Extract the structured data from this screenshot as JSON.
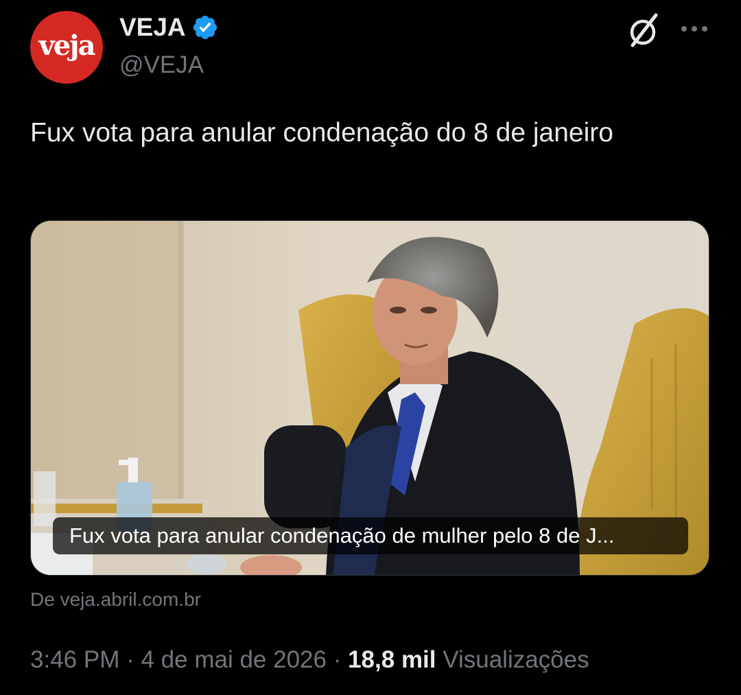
{
  "author": {
    "avatar_text": "veja",
    "display_name": "VEJA",
    "handle": "@VEJA"
  },
  "tweet": {
    "text": "Fux vota para anular condenação do 8 de janeiro"
  },
  "card": {
    "caption": "Fux vota para anular condenação de mulher pelo 8 de J...",
    "source": "De veja.abril.com.br"
  },
  "meta": {
    "time": "3:46 PM",
    "separator": "·",
    "date": "4 de mai de 2026",
    "views_count": "18,8 mil",
    "views_label": "Visualizações"
  },
  "colors": {
    "background": "#000000",
    "text_primary": "#e7e9ea",
    "text_secondary": "#71767b",
    "verified_blue": "#1d9bf0",
    "veja_red": "#d52a23"
  },
  "icons": {
    "verified": "verified-badge-icon",
    "grok": "grok-icon",
    "more": "more-options-icon"
  }
}
